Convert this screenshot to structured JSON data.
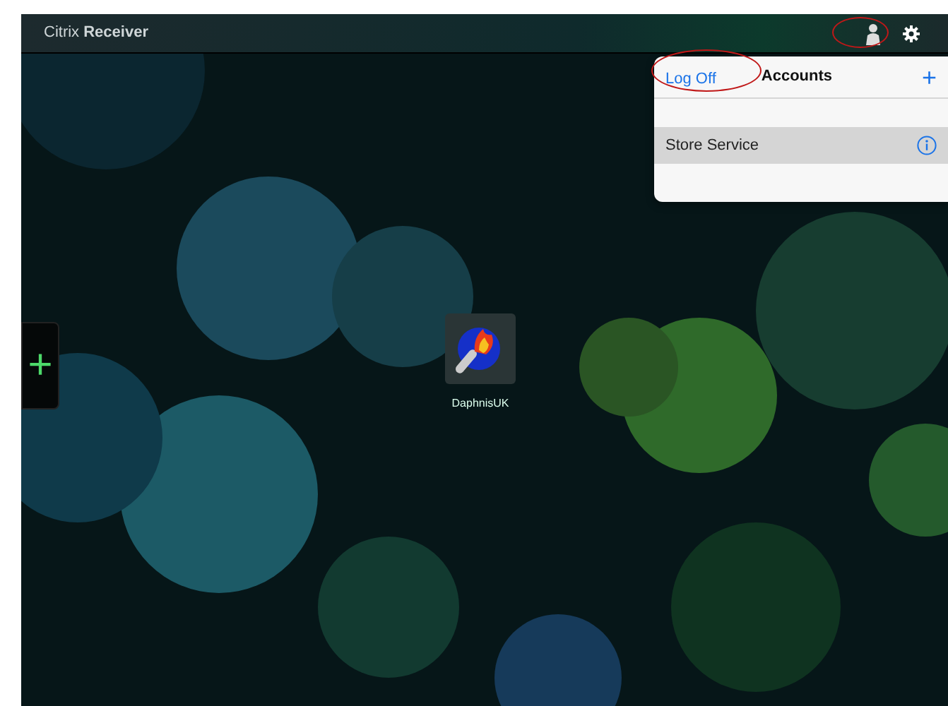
{
  "top_bar": {
    "logo": "Citrix **Receiver**",
    "account_button": {
      "circled": true
    }
  },
  "accounts_popover": {
    "left_button": {
      "text": "Log Off",
      "circled": true
    },
    "title": "Accounts",
    "add_button": "+",
    "stores": [
      {
        "name": "Store Service",
        "selected": true
      }
    ]
  },
  "apps": [
    {
      "name": "DaphnisUK"
    }
  ],
  "side_tab": {
    "label": "+"
  }
}
